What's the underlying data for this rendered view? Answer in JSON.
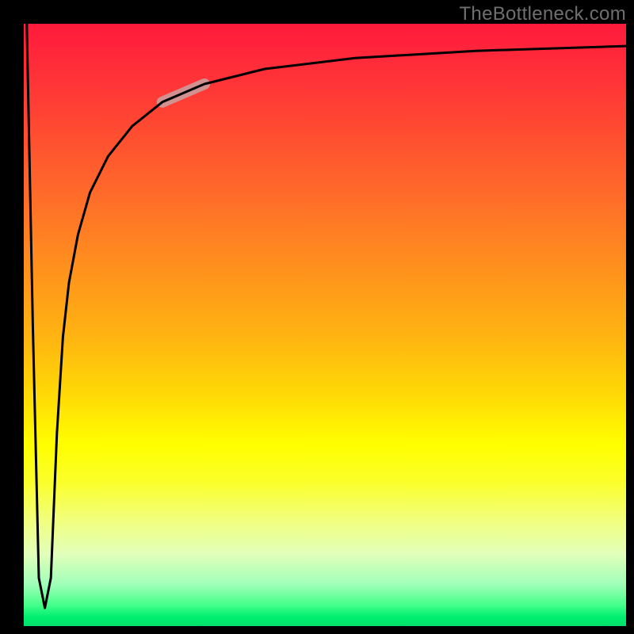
{
  "watermark": "TheBottleneck.com",
  "chart_data": {
    "type": "line",
    "title": "",
    "xlabel": "",
    "ylabel": "",
    "xlim": [
      0,
      100
    ],
    "ylim": [
      0,
      100
    ],
    "series": [
      {
        "name": "curve",
        "x": [
          0.5,
          1.5,
          2.5,
          3.5,
          4.5,
          5.0,
          5.5,
          6.5,
          7.5,
          9,
          11,
          14,
          18,
          23,
          30,
          40,
          55,
          75,
          100
        ],
        "y": [
          100,
          50,
          8,
          3,
          8,
          20,
          32,
          48,
          57,
          65,
          72,
          78,
          83,
          87,
          90,
          92.5,
          94.3,
          95.5,
          96.3
        ]
      }
    ],
    "highlight_segment": {
      "note": "pale thick stroke segment on rising curve",
      "x_range": [
        20,
        30
      ],
      "y_range": [
        82,
        88
      ]
    },
    "gradient_stops": [
      {
        "pos": 0.0,
        "color": "#ff1a3c"
      },
      {
        "pos": 0.3,
        "color": "#ff6a2a"
      },
      {
        "pos": 0.55,
        "color": "#ffb411"
      },
      {
        "pos": 0.72,
        "color": "#ffff00"
      },
      {
        "pos": 0.88,
        "color": "#e2ffbb"
      },
      {
        "pos": 0.97,
        "color": "#45ff8a"
      },
      {
        "pos": 1.0,
        "color": "#00e06a"
      }
    ]
  }
}
